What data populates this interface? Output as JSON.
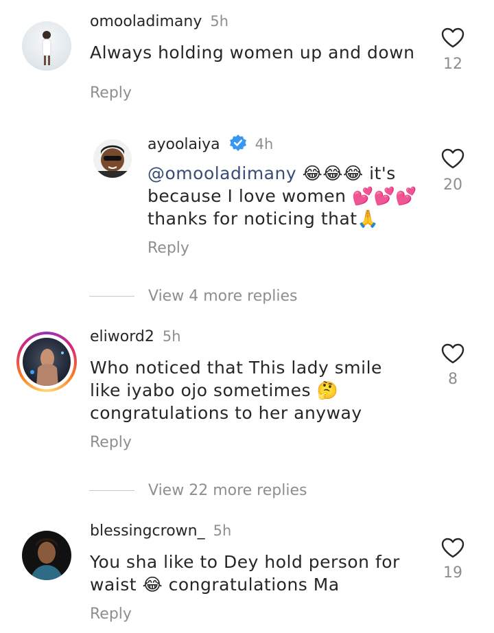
{
  "comments": [
    {
      "username": "omooladimany",
      "time": "5h",
      "text": "Always holding women up and down",
      "reply_label": "Reply",
      "likes": "12",
      "avatar_colors": [
        "#e9eef2",
        "#f6f7f9"
      ]
    },
    {
      "username": "ayoolaiya",
      "verified": true,
      "time": "4h",
      "mention": "@omooladimany",
      "text_line1_rest": " 😂😂😂 it's",
      "text_line2": "because I love women 💕💕💕",
      "text_line3": "thanks for noticing that🙏",
      "reply_label": "Reply",
      "likes": "20"
    },
    {
      "username": "eliword2",
      "time": "5h",
      "text_line1": "Who noticed that This lady smile",
      "text_line2": "like iyabo ojo sometimes 🤔",
      "text_line3": "congratulations to her anyway",
      "reply_label": "Reply",
      "likes": "8"
    },
    {
      "username": "blessingcrown_",
      "time": "5h",
      "text_line1": "You sha like to Dey hold person for",
      "text_line2": "waist 😂 congratulations Ma",
      "reply_label": "Reply",
      "likes": "19"
    }
  ],
  "view_more": [
    {
      "label": "View 4 more replies"
    },
    {
      "label": "View 22 more replies"
    }
  ],
  "colors": {
    "text": "#262626",
    "secondary": "#8e8e8e",
    "mention": "#374d7a",
    "verified": "#3897f0",
    "story_ring": [
      "#feda75",
      "#fa7e1e",
      "#d62976",
      "#962fbf"
    ]
  },
  "icons": {
    "like": "heart-outline-icon",
    "verified": "verified-badge-icon"
  }
}
